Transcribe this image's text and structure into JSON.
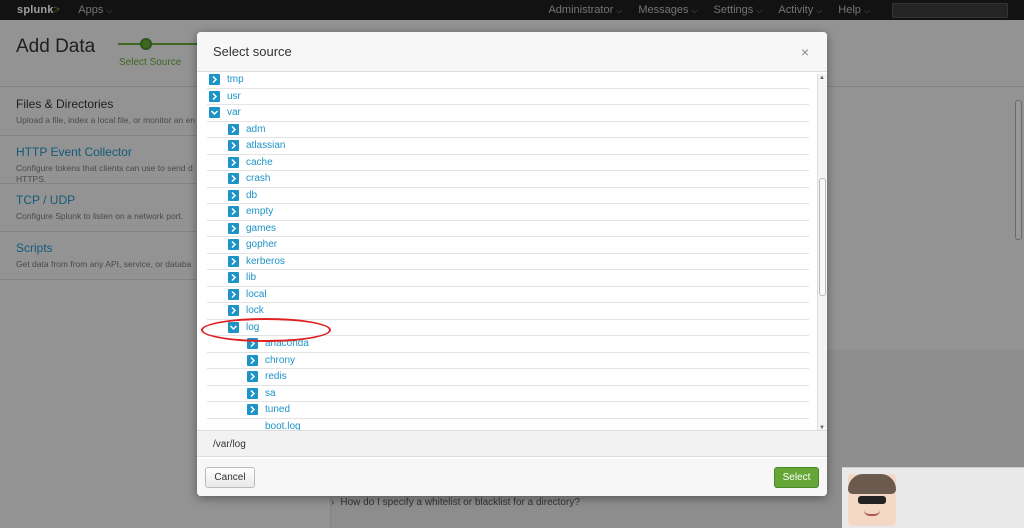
{
  "topnav": {
    "logo_text": "splunk",
    "logo_suffix": ">",
    "apps_label": "Apps",
    "menu": [
      "Administrator",
      "Messages",
      "Settings",
      "Activity",
      "Help"
    ]
  },
  "page": {
    "title": "Add Data",
    "step_label": "Select Source"
  },
  "sources": [
    {
      "title": "Files & Directories",
      "desc": "Upload a file, index a local file, or monitor an en"
    },
    {
      "title": "HTTP Event Collector",
      "desc": "Configure tokens that clients can use to send d",
      "desc2": "HTTPS."
    },
    {
      "title": "TCP / UDP",
      "desc": "Configure Splunk to listen on a network port."
    },
    {
      "title": "Scripts",
      "desc": "Get data from from any API, service, or databa"
    }
  ],
  "faq_text": "How do I specify a whitelist or blacklist for a directory?",
  "modal": {
    "title": "Select source",
    "close_glyph": "×",
    "selected_path": "/var/log",
    "cancel_label": "Cancel",
    "select_label": "Select"
  },
  "tree": [
    {
      "label": "tmp",
      "level": 0,
      "expanded": false
    },
    {
      "label": "usr",
      "level": 0,
      "expanded": false
    },
    {
      "label": "var",
      "level": 0,
      "expanded": true
    },
    {
      "label": "adm",
      "level": 1,
      "expanded": false
    },
    {
      "label": "atlassian",
      "level": 1,
      "expanded": false
    },
    {
      "label": "cache",
      "level": 1,
      "expanded": false
    },
    {
      "label": "crash",
      "level": 1,
      "expanded": false
    },
    {
      "label": "db",
      "level": 1,
      "expanded": false
    },
    {
      "label": "empty",
      "level": 1,
      "expanded": false
    },
    {
      "label": "games",
      "level": 1,
      "expanded": false
    },
    {
      "label": "gopher",
      "level": 1,
      "expanded": false
    },
    {
      "label": "kerberos",
      "level": 1,
      "expanded": false
    },
    {
      "label": "lib",
      "level": 1,
      "expanded": false
    },
    {
      "label": "local",
      "level": 1,
      "expanded": false
    },
    {
      "label": "lock",
      "level": 1,
      "expanded": false
    },
    {
      "label": "log",
      "level": 1,
      "expanded": true
    },
    {
      "label": "anaconda",
      "level": 2,
      "expanded": false
    },
    {
      "label": "chrony",
      "level": 2,
      "expanded": false
    },
    {
      "label": "redis",
      "level": 2,
      "expanded": false
    },
    {
      "label": "sa",
      "level": 2,
      "expanded": false
    },
    {
      "label": "tuned",
      "level": 2,
      "expanded": false
    },
    {
      "label": "boot.log",
      "level": 2,
      "file": true
    }
  ],
  "colors": {
    "accent": "#1e93c6",
    "brand_green": "#65a637",
    "annotation_red": "#e02020"
  }
}
